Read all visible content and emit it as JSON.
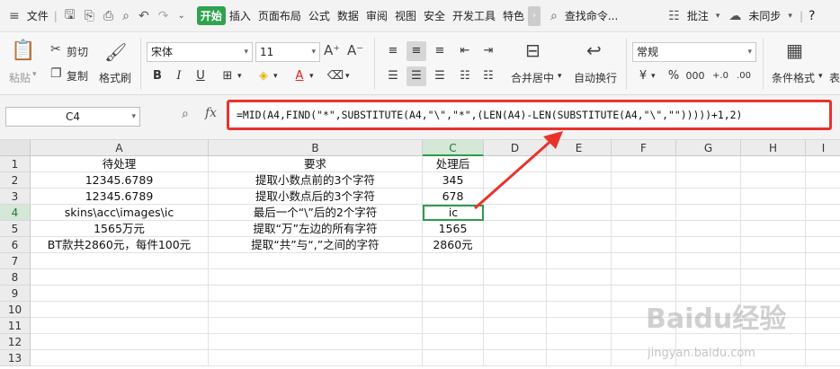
{
  "menubar": {
    "file": "文件",
    "tabs": [
      "开始",
      "插入",
      "页面布局",
      "公式",
      "数据",
      "审阅",
      "视图",
      "安全",
      "开发工具",
      "特色"
    ],
    "search": "查找命令...",
    "comment": "批注",
    "sync": "未同步",
    "help": "?"
  },
  "ribbon": {
    "paste": "粘贴",
    "cut": "剪切",
    "copy": "复制",
    "format_painter": "格式刷",
    "font_name": "宋体",
    "font_size": "11",
    "merge_center": "合并居中",
    "wrap_text": "自动换行",
    "number_format": "常规",
    "conditional_format": "条件格式",
    "table_style": "表"
  },
  "formula": {
    "name_box": "C4",
    "fx": "fx",
    "text": "=MID(A4,FIND(\"*\",SUBSTITUTE(A4,\"\\\",\"*\",(LEN(A4)-LEN(SUBSTITUTE(A4,\"\\\",\"\")))))+1,2)"
  },
  "columns": [
    "A",
    "B",
    "C",
    "D",
    "E",
    "F",
    "G",
    "H",
    "I"
  ],
  "rows": [
    "1",
    "2",
    "3",
    "4",
    "5",
    "6",
    "7",
    "8",
    "9",
    "10",
    "11",
    "12",
    "13"
  ],
  "cells": [
    {
      "row": 1,
      "a": "待处理",
      "b": "要求",
      "c": "处理后"
    },
    {
      "row": 2,
      "a": "12345.6789",
      "b": "提取小数点前的3个字符",
      "c": "345"
    },
    {
      "row": 3,
      "a": "12345.6789",
      "b": "提取小数点后的3个字符",
      "c": "678"
    },
    {
      "row": 4,
      "a": "skins\\acc\\images\\ic",
      "b": "最后一个“\\”后的2个字符",
      "c": "ic"
    },
    {
      "row": 5,
      "a": "1565万元",
      "b": "提取“万”左边的所有字符",
      "c": "1565"
    },
    {
      "row": 6,
      "a": "BT款共2860元，每件100元",
      "b": "提取“共”与“,”之间的字符",
      "c": "2860元"
    }
  ],
  "watermark": {
    "main": "Baidu经验",
    "sub": "jingyan.baidu.com"
  },
  "colors": {
    "accent": "#2fa34f",
    "highlight": "#e8332d"
  }
}
